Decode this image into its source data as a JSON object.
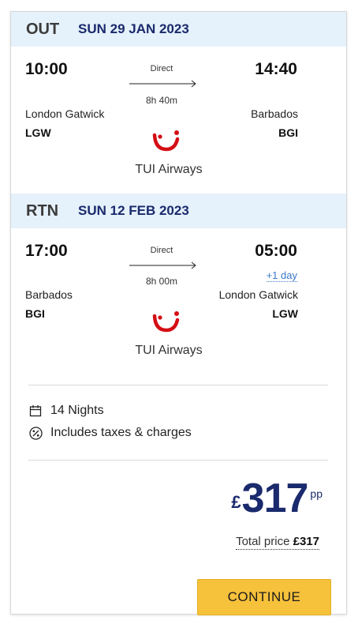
{
  "outbound": {
    "code": "OUT",
    "date": "SUN 29 JAN 2023",
    "depart_time": "10:00",
    "arrive_time": "14:40",
    "stops": "Direct",
    "duration": "8h 40m",
    "from_city": "London Gatwick",
    "from_code": "LGW",
    "to_city": "Barbados",
    "to_code": "BGI",
    "airline": "TUI Airways"
  },
  "return": {
    "code": "RTN",
    "date": "SUN 12 FEB 2023",
    "depart_time": "17:00",
    "arrive_time": "05:00",
    "plus_day": "+1 day",
    "stops": "Direct",
    "duration": "8h 00m",
    "from_city": "Barbados",
    "from_code": "BGI",
    "to_city": "London Gatwick",
    "to_code": "LGW",
    "airline": "TUI Airways"
  },
  "summary": {
    "nights": "14 Nights",
    "taxes": "Includes taxes & charges",
    "nights_icon": "calendar-icon",
    "taxes_icon": "percent-icon"
  },
  "price": {
    "currency": "£",
    "amount": "317",
    "per_person": "pp",
    "total_label": "Total price",
    "total_value": "£317"
  },
  "actions": {
    "continue_label": "CONTINUE"
  },
  "colors": {
    "header_bg": "#e5f1fb",
    "brand_navy": "#1a2a6c",
    "tui_red": "#d40e14",
    "cta_yellow": "#f6c13b",
    "link_blue": "#3a79c9"
  }
}
